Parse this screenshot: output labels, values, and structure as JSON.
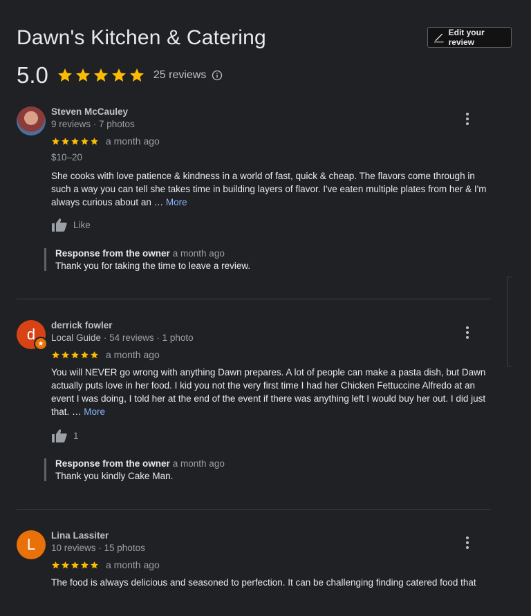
{
  "header": {
    "title": "Dawn's Kitchen & Catering",
    "edit_label": "Edit your review",
    "rating": "5.0",
    "review_count": "25 reviews"
  },
  "colors": {
    "star": "#fbbc04",
    "link": "#8ab4f8",
    "background": "#202124"
  },
  "icons": [
    "pencil-icon",
    "star-icon",
    "info-icon",
    "more-vert-icon",
    "thumb-up-icon"
  ],
  "reviews": [
    {
      "name": "Steven McCauley",
      "meta": "9 reviews · 7 photos",
      "stars": 5,
      "time": "a month ago",
      "price": "$10–20",
      "text": "She cooks with love patience & kindness in a world of fast, quick & cheap.  The flavors come through in such a way you can tell she takes time in building layers of flavor.  I've eaten multiple plates from her & I'm always curious about an …",
      "more": "More",
      "like_label": "Like",
      "owner_heading": "Response from the owner",
      "owner_time": "a month ago",
      "owner_text": "Thank you for taking the time to leave a review."
    },
    {
      "name": "derrick fowler",
      "avatar_letter": "d",
      "guide": "Local Guide",
      "meta": "· 54 reviews · 1 photo",
      "stars": 5,
      "time": "a month ago",
      "text": "You will NEVER go wrong with anything Dawn prepares. A lot of people can make a pasta dish, but Dawn actually puts love in her food. I kid you not the very first time I had her Chicken Fettuccine Alfredo at an event I was doing, I told her at the end of the event if there was anything left I would buy her out. I did just that. …",
      "more": "More",
      "like_label": "1",
      "owner_heading": "Response from the owner",
      "owner_time": "a month ago",
      "owner_text": "Thank you kindly Cake Man."
    },
    {
      "name": "Lina Lassiter",
      "avatar_letter": "L",
      "meta": "10 reviews · 15 photos",
      "stars": 5,
      "time": "a month ago",
      "text": "The food is always delicious and seasoned to perfection.  It can be challenging finding catered food that"
    }
  ]
}
